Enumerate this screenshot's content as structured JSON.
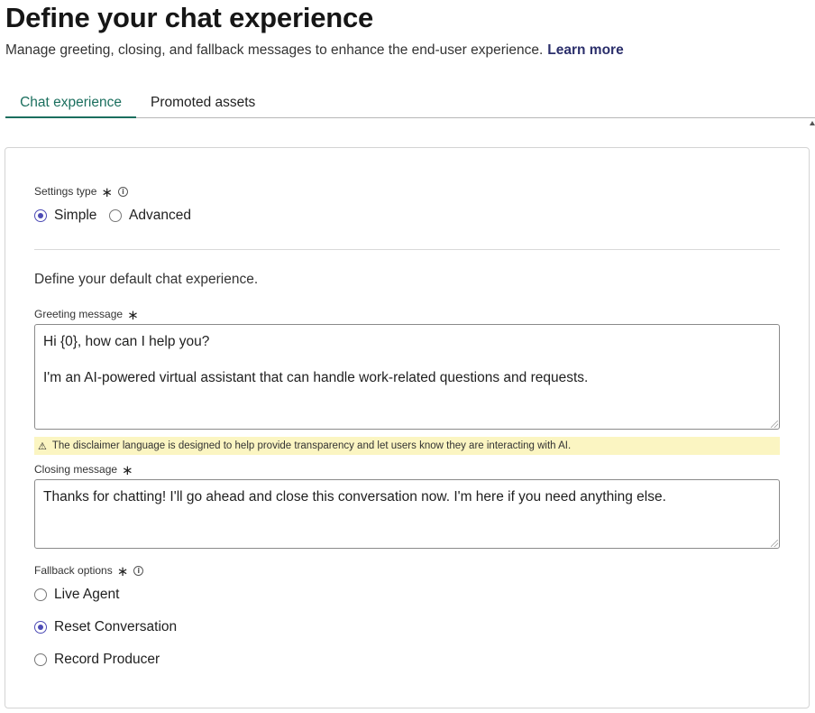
{
  "header": {
    "title": "Define your chat experience",
    "subtitle": "Manage greeting, closing, and fallback messages to enhance the end-user experience.",
    "learn_more": "Learn more"
  },
  "tabs": [
    {
      "label": "Chat experience",
      "active": true
    },
    {
      "label": "Promoted assets",
      "active": false
    }
  ],
  "settings_type": {
    "label": "Settings type",
    "required_mark": "∗",
    "options": [
      {
        "label": "Simple",
        "selected": true
      },
      {
        "label": "Advanced",
        "selected": false
      }
    ]
  },
  "intro": "Define your default chat experience.",
  "greeting": {
    "label": "Greeting message",
    "required_mark": "∗",
    "line1": "Hi {0}, how can I help you?",
    "line2": "I'm an AI-powered virtual assistant that can handle work-related questions and requests."
  },
  "disclaimer": {
    "icon": "warning-icon",
    "text": "The disclaimer language is designed to help provide transparency and let users know they are interacting with AI."
  },
  "closing": {
    "label": "Closing message",
    "required_mark": "∗",
    "text": "Thanks for chatting! I'll go ahead and close this conversation now. I'm here if you need anything else."
  },
  "fallback": {
    "label": "Fallback options",
    "required_mark": "∗",
    "options": [
      {
        "label": "Live Agent",
        "selected": false
      },
      {
        "label": "Reset Conversation",
        "selected": true
      },
      {
        "label": "Record Producer",
        "selected": false
      }
    ]
  },
  "colors": {
    "tab_active": "#1b6f5e",
    "radio_selected": "#4d4bb5",
    "link": "#2b2f6b",
    "disclaimer_bg": "#fbf5c2"
  }
}
